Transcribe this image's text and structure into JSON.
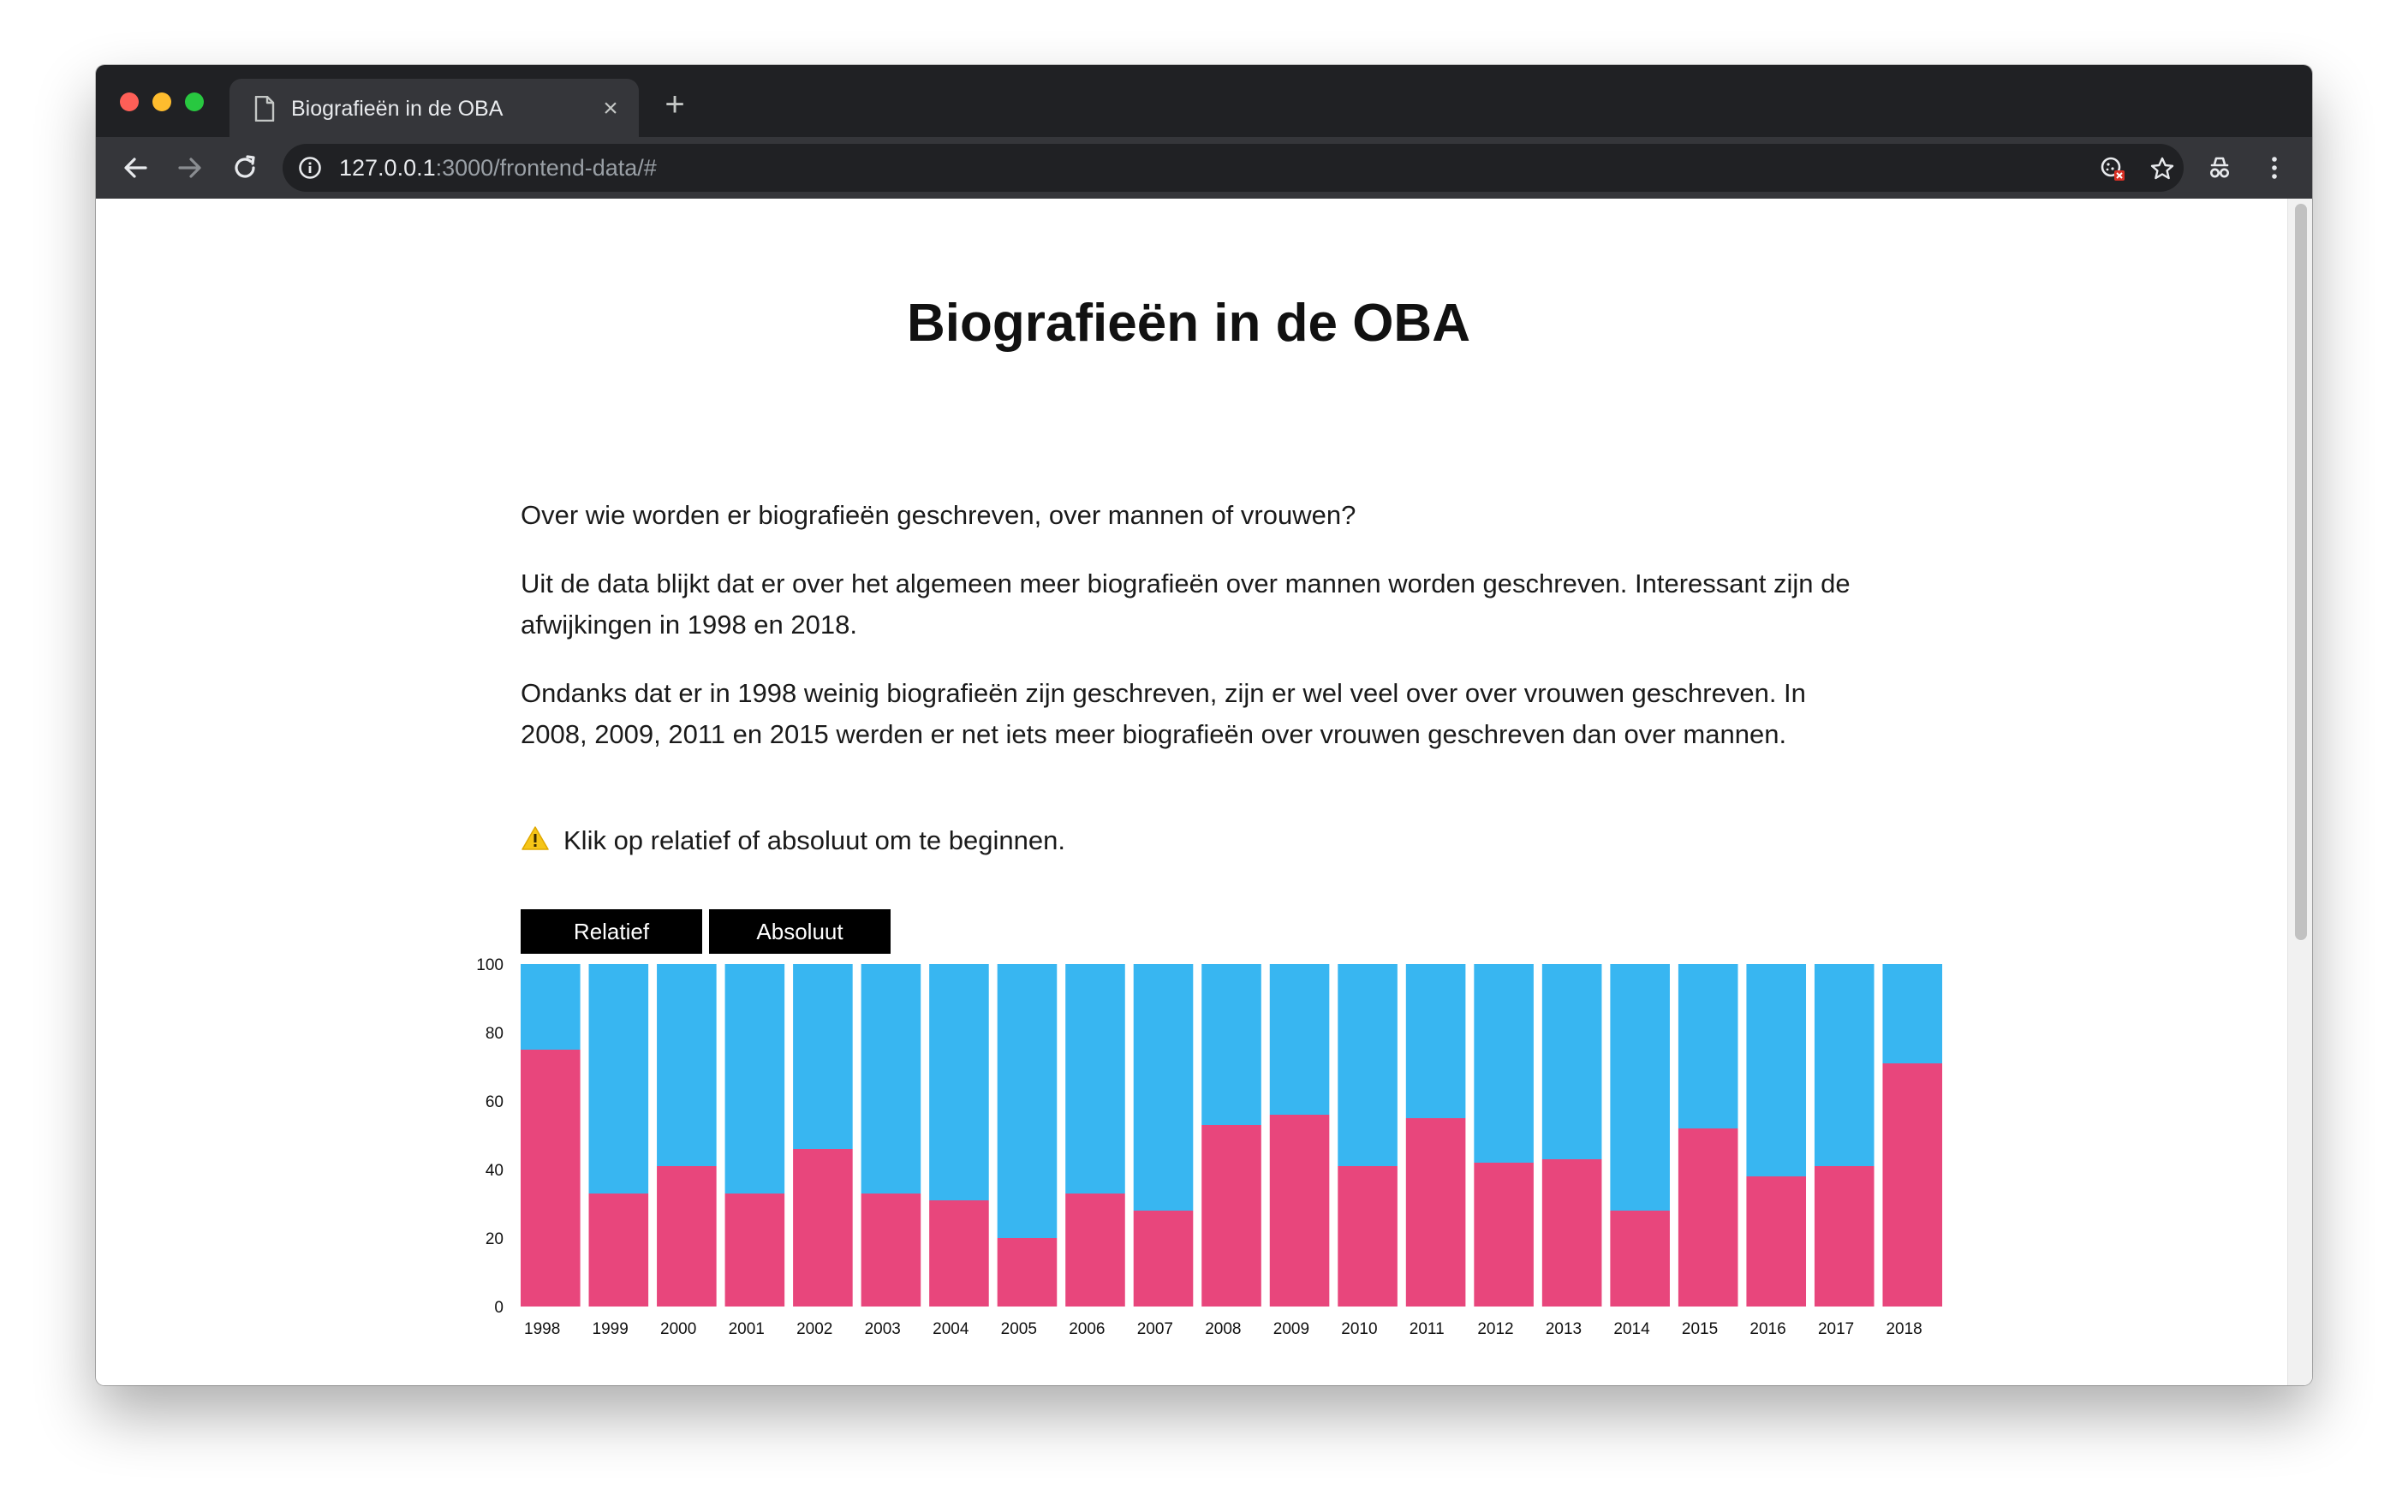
{
  "browser": {
    "tab_title": "Biografieën in de OBA",
    "tab_close": "×",
    "new_tab": "+",
    "url_host": "127.0.0.1",
    "url_path": ":3000/frontend-data/#"
  },
  "page": {
    "title": "Biografieën in de OBA",
    "paragraphs": [
      "Over wie worden er biografieën geschreven, over mannen of vrouwen?",
      "Uit de data blijkt dat er over het algemeen meer biografieën over mannen worden geschreven. Interessant zijn de afwijkingen in 1998 en 2018.",
      "Ondanks dat er in 1998 weinig biografieën zijn geschreven, zijn er wel veel over over vrouwen geschreven. In 2008, 2009, 2011 en 2015 werden er net iets meer biografieën over vrouwen geschreven dan over mannen."
    ],
    "warning_text": "Klik op relatief of absoluut om te beginnen.",
    "buttons": {
      "relative": "Relatief",
      "absolute": "Absoluut"
    }
  },
  "colors": {
    "women": "#e8467c",
    "men": "#38b6f1",
    "chrome_dark": "#202124",
    "button_bg": "#000000"
  },
  "chart_data": {
    "type": "bar",
    "stacked": true,
    "categories": [
      "1998",
      "1999",
      "2000",
      "2001",
      "2002",
      "2003",
      "2004",
      "2005",
      "2006",
      "2007",
      "2008",
      "2009",
      "2010",
      "2011",
      "2012",
      "2013",
      "2014",
      "2015",
      "2016",
      "2017",
      "2018"
    ],
    "series": [
      {
        "values": [
          75,
          33,
          41,
          33,
          46,
          33,
          31,
          20,
          33,
          28,
          53,
          56,
          41,
          55,
          42,
          43,
          28,
          52,
          38,
          41,
          71
        ]
      },
      {
        "values": [
          25,
          67,
          59,
          67,
          54,
          67,
          69,
          80,
          67,
          72,
          47,
          44,
          59,
          45,
          58,
          57,
          72,
          48,
          62,
          59,
          29
        ]
      }
    ],
    "ylim": [
      0,
      100
    ],
    "yticks": [
      0,
      20,
      40,
      60,
      80,
      100
    ],
    "title": "",
    "xlabel": "",
    "ylabel": "",
    "grid": false
  }
}
